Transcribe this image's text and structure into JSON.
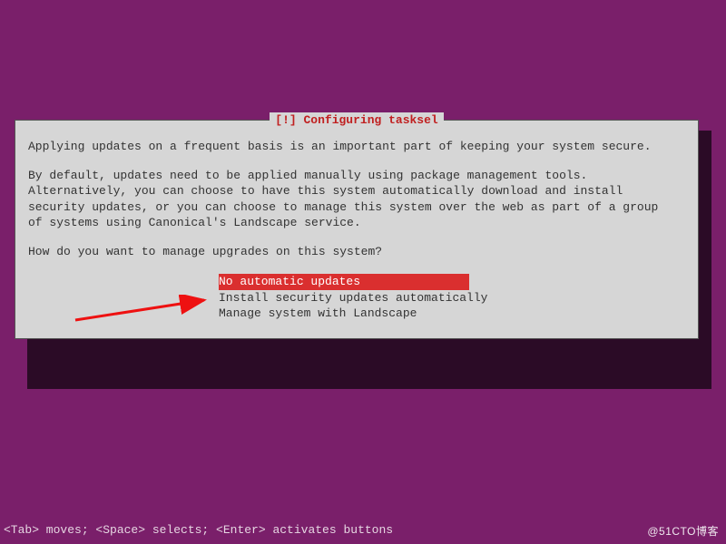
{
  "dialog": {
    "title": "[!] Configuring tasksel",
    "paragraph1": "Applying updates on a frequent basis is an important part of keeping your system secure.",
    "paragraph2": "By default, updates need to be applied manually using package management tools.\nAlternatively, you can choose to have this system automatically download and install\nsecurity updates, or you can choose to manage this system over the web as part of a group\nof systems using Canonical's Landscape service.",
    "question": "How do you want to manage upgrades on this system?",
    "options": [
      {
        "label": "No automatic updates",
        "selected": true
      },
      {
        "label": "Install security updates automatically",
        "selected": false
      },
      {
        "label": "Manage system with Landscape",
        "selected": false
      }
    ]
  },
  "hintbar": "<Tab> moves; <Space> selects; <Enter> activates buttons",
  "watermark": "@51CTO博客",
  "colors": {
    "background": "#7a1f6a",
    "dialog_bg": "#d6d6d6",
    "title_fg": "#c02020",
    "highlight_bg": "#da2f2f",
    "highlight_fg": "#ffffff"
  }
}
